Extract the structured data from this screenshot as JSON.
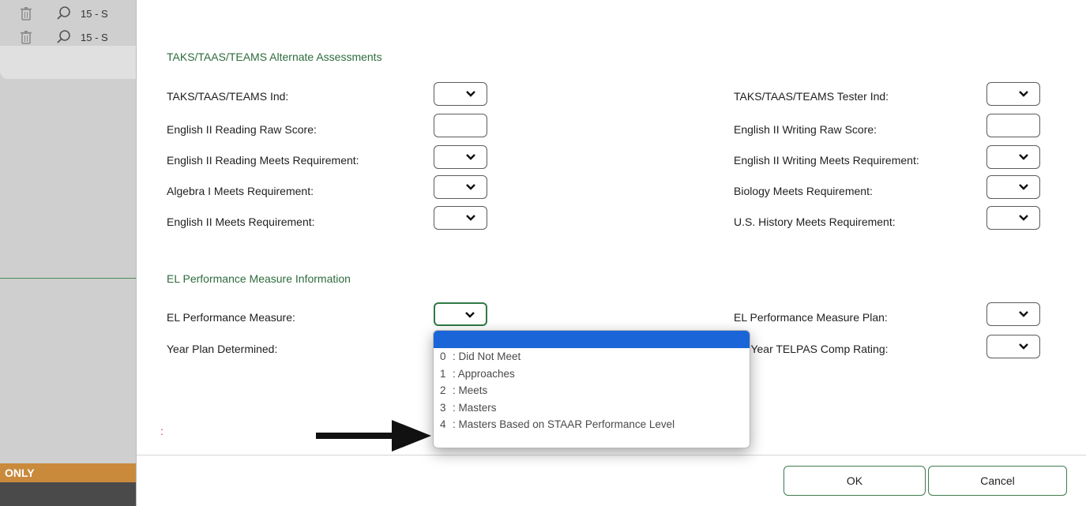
{
  "background": {
    "rows": [
      {
        "text": "15 - S"
      },
      {
        "text": "15 - S"
      }
    ],
    "only_label": "ONLY"
  },
  "sections": {
    "taks": {
      "title": "TAKS/TAAS/TEAMS Alternate Assessments",
      "left": [
        {
          "label": "TAKS/TAAS/TEAMS Ind:",
          "control": "select",
          "value": ""
        },
        {
          "label": "English II Reading Raw Score:",
          "control": "text",
          "value": ""
        },
        {
          "label": "English II Reading Meets Requirement:",
          "control": "select",
          "value": ""
        },
        {
          "label": "Algebra I Meets Requirement:",
          "control": "select",
          "value": ""
        },
        {
          "label": "English II Meets Requirement:",
          "control": "select",
          "value": ""
        }
      ],
      "right": [
        {
          "label": "TAKS/TAAS/TEAMS Tester Ind:",
          "control": "select",
          "value": ""
        },
        {
          "label": "English II Writing Raw Score:",
          "control": "text",
          "value": ""
        },
        {
          "label": "English II Writing Meets Requirement:",
          "control": "select",
          "value": ""
        },
        {
          "label": "Biology Meets Requirement:",
          "control": "select",
          "value": ""
        },
        {
          "label": "U.S. History Meets Requirement:",
          "control": "select",
          "value": ""
        }
      ]
    },
    "el": {
      "title": "EL Performance Measure Information",
      "left": [
        {
          "label": "EL Performance Measure:"
        },
        {
          "label": "Year Plan Determined:"
        }
      ],
      "right": [
        {
          "label": "EL Performance Measure Plan:"
        },
        {
          "label": "n-Year TELPAS Comp Rating:"
        }
      ]
    }
  },
  "dropdown": {
    "options": [
      {
        "code": "",
        "text": ""
      },
      {
        "code": "0",
        "text": ": Did Not Meet"
      },
      {
        "code": "1",
        "text": ": Approaches"
      },
      {
        "code": "2",
        "text": ": Meets"
      },
      {
        "code": "3",
        "text": ": Masters"
      },
      {
        "code": "4",
        "text": ": Masters Based on STAAR Performance Level"
      }
    ]
  },
  "footer": {
    "required_marker": ":",
    "ok_label": "OK",
    "cancel_label": "Cancel"
  },
  "colors": {
    "accent_green": "#2e6b3c",
    "highlight_blue": "#1a66d9",
    "only_orange": "#c98a3c"
  }
}
